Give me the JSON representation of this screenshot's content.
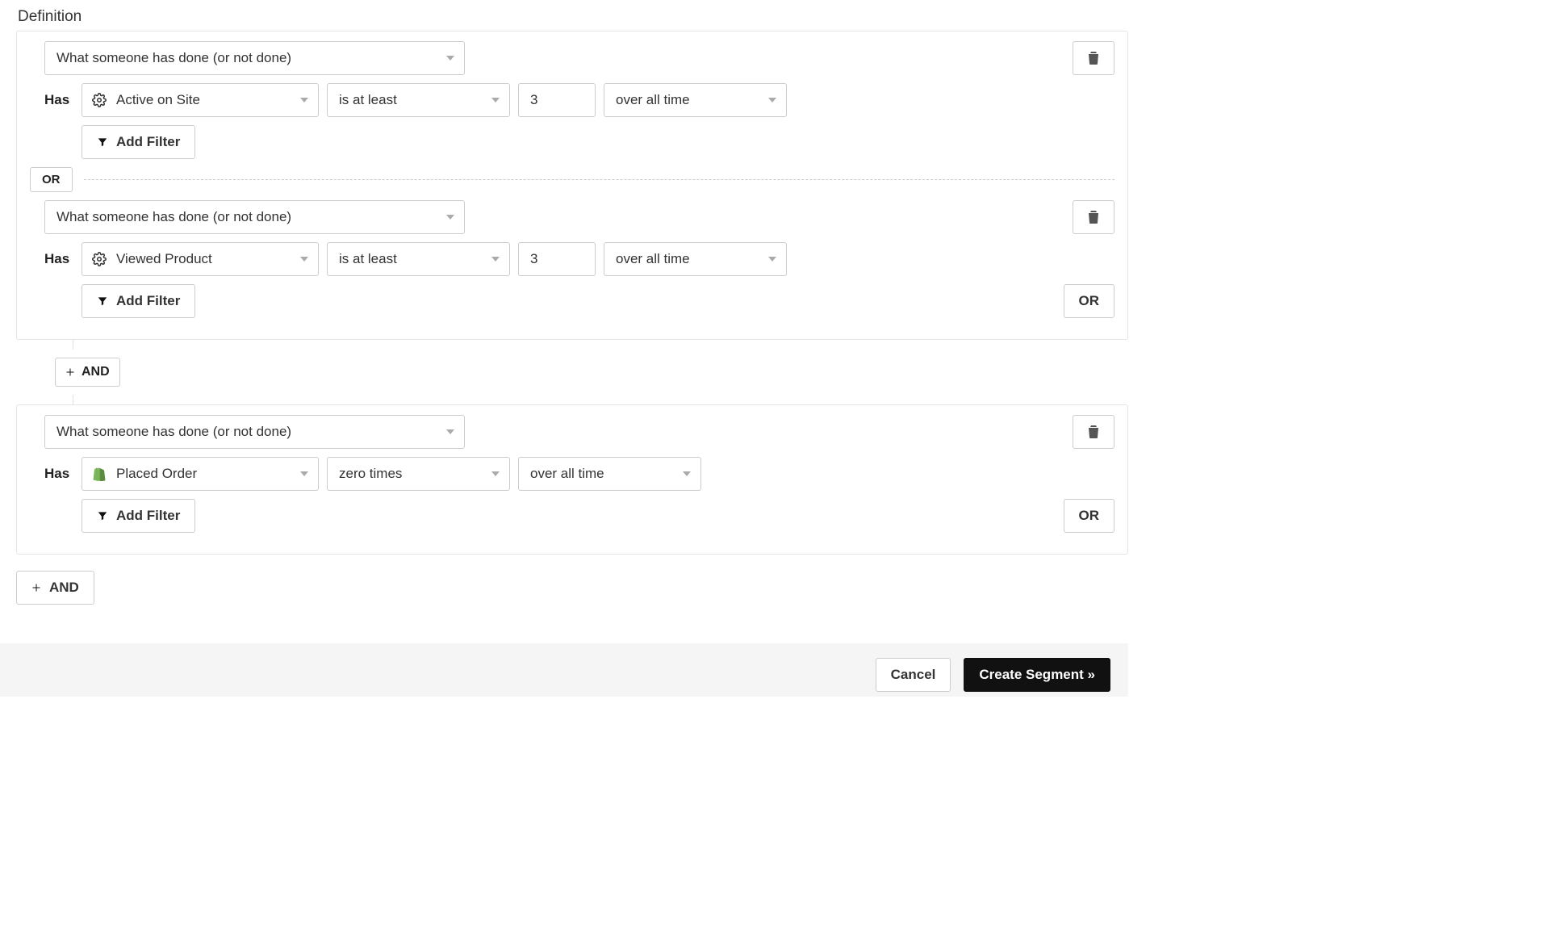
{
  "title": "Definition",
  "labels": {
    "has": "Has",
    "add_filter": "Add Filter",
    "or": "OR",
    "and": "AND",
    "and_plus": "AND",
    "cancel": "Cancel",
    "create_segment": "Create Segment »"
  },
  "groups": [
    {
      "conditions": [
        {
          "type_label": "What someone has done (or not done)",
          "metric": "Active on Site",
          "metric_icon": "gear",
          "op": "is at least",
          "value": "3",
          "time": "over all time"
        },
        {
          "type_label": "What someone has done (or not done)",
          "metric": "Viewed Product",
          "metric_icon": "gear",
          "op": "is at least",
          "value": "3",
          "time": "over all time"
        }
      ]
    },
    {
      "conditions": [
        {
          "type_label": "What someone has done (or not done)",
          "metric": "Placed Order",
          "metric_icon": "shopify",
          "op": "zero times",
          "value": "",
          "time": "over all time"
        }
      ]
    }
  ]
}
